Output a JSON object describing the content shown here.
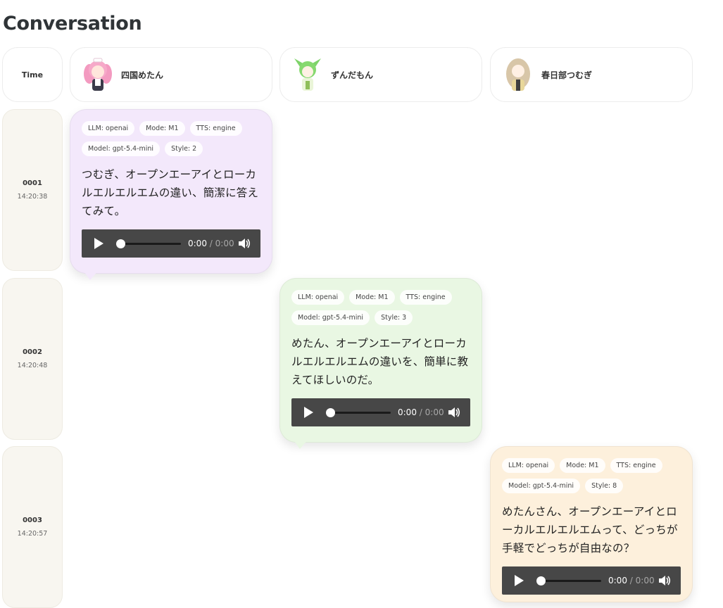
{
  "page": {
    "title": "Conversation"
  },
  "header": {
    "time_label": "Time",
    "characters": [
      {
        "name": "四国めたん",
        "avatar": "metan-avatar"
      },
      {
        "name": "ずんだもん",
        "avatar": "zundamon-avatar"
      },
      {
        "name": "春日部つむぎ",
        "avatar": "tsumugi-avatar"
      }
    ]
  },
  "colors": {
    "metan_bubble": "#f3e8fb",
    "zundamon_bubble": "#e9f7e3",
    "tsumugi_bubble": "#fdf0dc",
    "time_cell": "#f8f6f0",
    "player": "#474747"
  },
  "messages": [
    {
      "id": "0001",
      "time": "14:20:38",
      "speaker": "四国めたん",
      "chips": [
        "LLM: openai",
        "Mode: M1",
        "TTS: engine",
        "Model: gpt-5.4-mini",
        "Style: 2"
      ],
      "text": "つむぎ、オープンエーアイとローカルエルエルエムの違い、簡潔に答えてみて。",
      "audio": {
        "current": "0:00",
        "duration": "0:00"
      }
    },
    {
      "id": "0002",
      "time": "14:20:48",
      "speaker": "ずんだもん",
      "chips": [
        "LLM: openai",
        "Mode: M1",
        "TTS: engine",
        "Model: gpt-5.4-mini",
        "Style: 3"
      ],
      "text": "めたん、オープンエーアイとローカルエルエルエムの違いを、簡単に教えてほしいのだ。",
      "audio": {
        "current": "0:00",
        "duration": "0:00"
      }
    },
    {
      "id": "0003",
      "time": "14:20:57",
      "speaker": "春日部つむぎ",
      "chips": [
        "LLM: openai",
        "Mode: M1",
        "TTS: engine",
        "Model: gpt-5.4-mini",
        "Style: 8"
      ],
      "text": "めたんさん、オープンエーアイとローカルエルエルエムって、どっちが手軽でどっちが自由なの？",
      "audio": {
        "current": "0:00",
        "duration": "0:00"
      }
    }
  ],
  "audio_sep": "/",
  "icons": {
    "play": "play-icon",
    "volume": "volume-icon"
  }
}
